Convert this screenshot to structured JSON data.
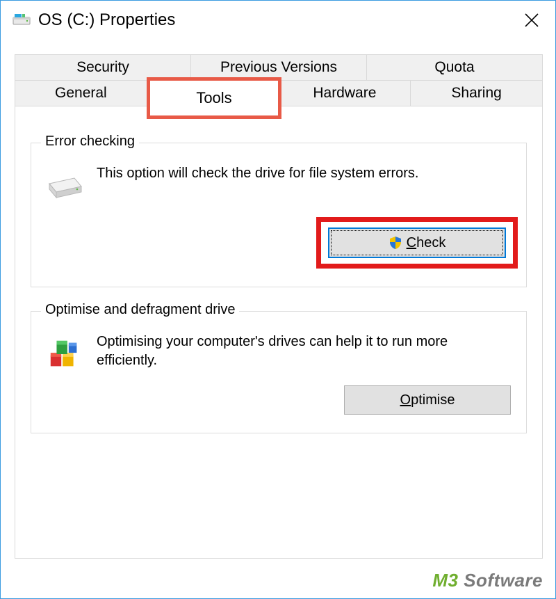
{
  "window": {
    "title": "OS (C:) Properties"
  },
  "tabs": {
    "row1": [
      "Security",
      "Previous Versions",
      "Quota"
    ],
    "row2": [
      "General",
      "Tools",
      "Hardware",
      "Sharing"
    ],
    "active": "Tools"
  },
  "error_checking": {
    "legend": "Error checking",
    "text": "This option will check the drive for file system errors.",
    "button_before_mnemonic": "",
    "button_mnemonic": "C",
    "button_after_mnemonic": "heck"
  },
  "defrag": {
    "legend": "Optimise and defragment drive",
    "text": "Optimising your computer's drives can help it to run more efficiently.",
    "button_before_mnemonic": "",
    "button_mnemonic": "O",
    "button_after_mnemonic": "ptimise"
  },
  "watermark": {
    "brand": "M3",
    "rest": " Software"
  }
}
